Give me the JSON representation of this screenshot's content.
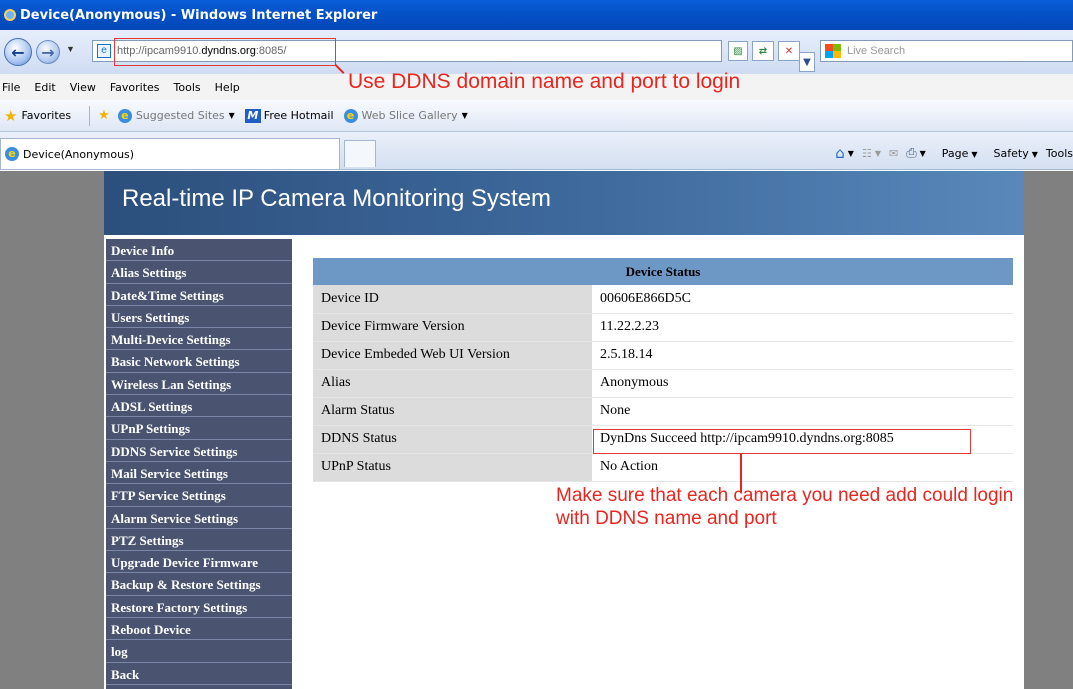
{
  "window": {
    "title": "Device(Anonymous) - Windows Internet Explorer"
  },
  "address_bar": {
    "url_prefix": "http://ipcam9910.",
    "url_domain": "dyndns.org",
    "url_suffix": ":8085/",
    "search_placeholder": "Live Search"
  },
  "menu": [
    "File",
    "Edit",
    "View",
    "Favorites",
    "Tools",
    "Help"
  ],
  "favorites_bar": {
    "favorites_label": "Favorites",
    "suggested_sites": "Suggested Sites",
    "free_hotmail": "Free Hotmail",
    "web_slice_gallery": "Web Slice Gallery"
  },
  "tabs": {
    "active_tab": "Device(Anonymous)"
  },
  "command_bar": {
    "page": "Page",
    "safety": "Safety",
    "tools": "Tools"
  },
  "annotations": {
    "url_note": "Use DDNS domain name and port to login",
    "ddns_note": "Make sure that each camera you need add could login with DDNS name and port"
  },
  "page": {
    "banner_title": "Real-time IP Camera Monitoring System",
    "nav_items": [
      "Device Info",
      "Alias Settings",
      "Date&Time Settings",
      "Users Settings",
      "Multi-Device Settings",
      "Basic Network Settings",
      "Wireless Lan Settings",
      "ADSL Settings",
      "UPnP Settings",
      "DDNS Service Settings",
      "Mail Service Settings",
      "FTP Service Settings",
      "Alarm Service Settings",
      "PTZ Settings",
      "Upgrade Device Firmware",
      "Backup & Restore Settings",
      "Restore Factory Settings",
      "Reboot Device",
      "log",
      "Back"
    ],
    "status_table": {
      "header": "Device Status",
      "rows": [
        {
          "label": "Device ID",
          "value": "00606E866D5C"
        },
        {
          "label": "Device Firmware Version",
          "value": "11.22.2.23"
        },
        {
          "label": "Device Embeded Web UI Version",
          "value": "2.5.18.14"
        },
        {
          "label": "Alias",
          "value": "Anonymous"
        },
        {
          "label": "Alarm Status",
          "value": "None"
        },
        {
          "label": "DDNS Status",
          "value": "DynDns Succeed  http://ipcam9910.dyndns.org:8085"
        },
        {
          "label": "UPnP Status",
          "value": "No Action"
        }
      ]
    }
  },
  "colors": {
    "annotation_red": "#e8261f",
    "nav_bg": "#4a5470",
    "table_header": "#6d98c5",
    "banner": "#3f6b9f"
  }
}
